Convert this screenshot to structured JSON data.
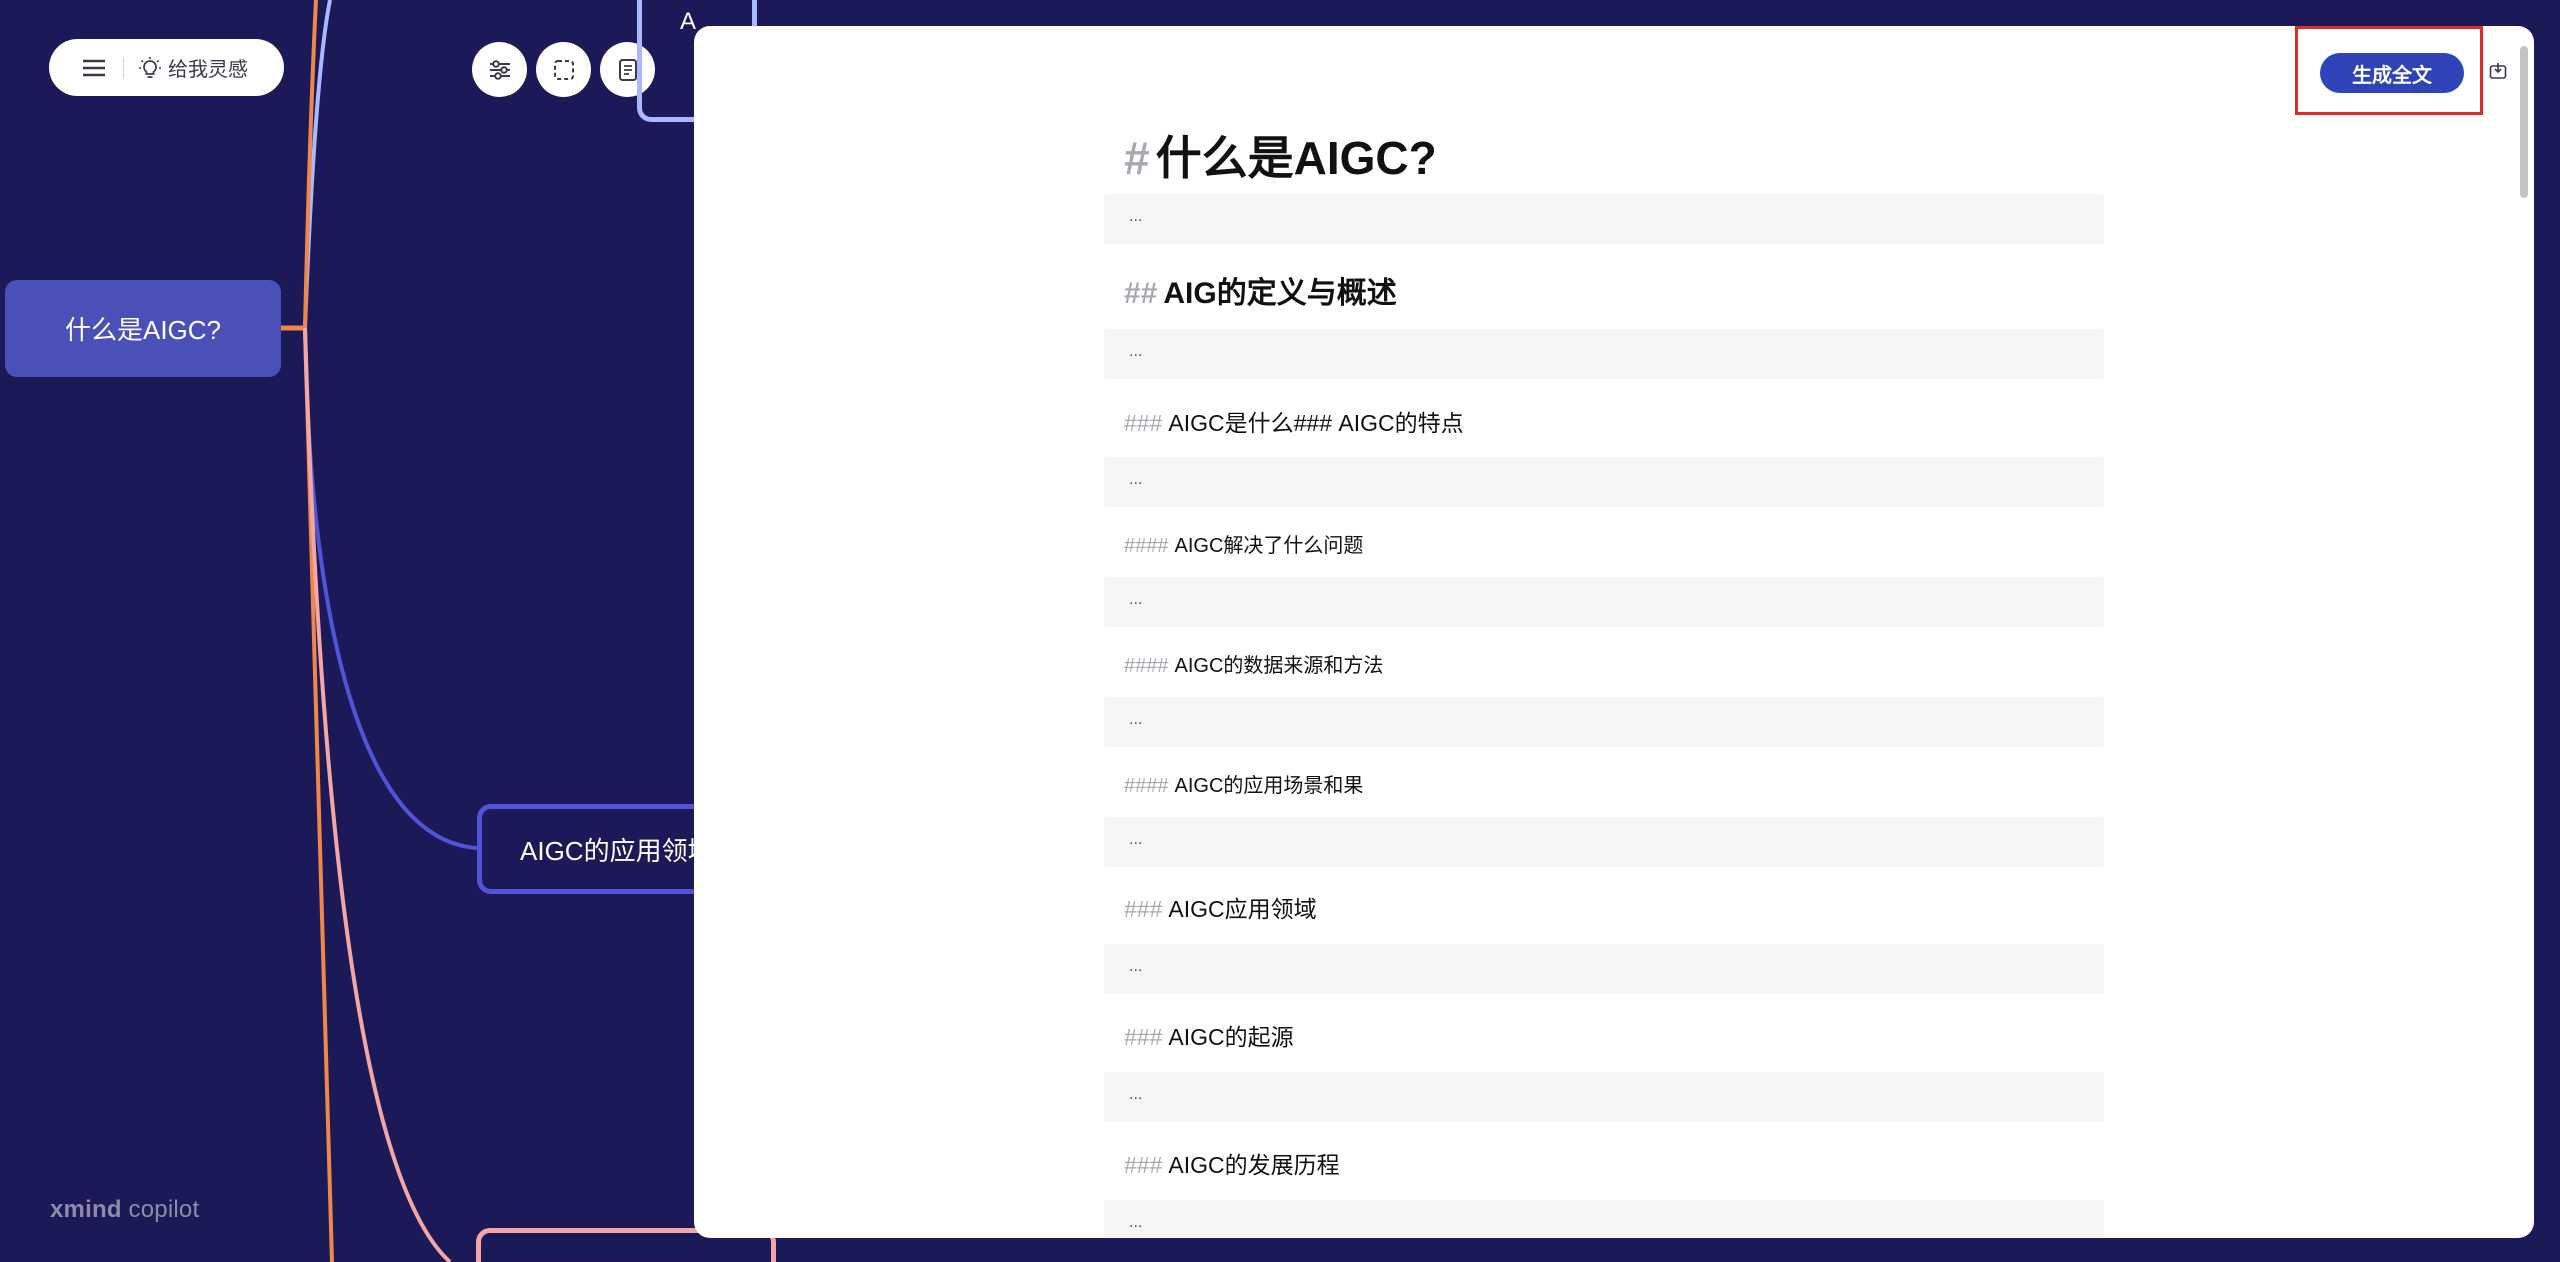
{
  "toolbar": {
    "inspire_label": "给我灵感"
  },
  "mindmap": {
    "root_topic": "什么是AIGC?",
    "top_topic_fragment": "A",
    "sub_topic": "AIGC的应用领域",
    "brand_bold": "xmind",
    "brand_rest": " copilot",
    "colors": {
      "background": "#1c1958",
      "root": "#4b4fb8",
      "branch_orange": "#f0864a",
      "branch_blue": "#4f55d6",
      "branch_light_blue": "#a9b8ff",
      "branch_pink": "#f3a6a6"
    }
  },
  "panel": {
    "generate_button": "生成全文",
    "accent": "#2d43b7",
    "highlight": "#e02b2b",
    "placeholder": "...",
    "h1": {
      "mark": "#",
      "text": "什么是AIGC?"
    },
    "h2": {
      "mark": "##",
      "text": "AIG的定义与概述"
    },
    "h3_a": {
      "mark": "###",
      "text": "AIGC是什么### AIGC的特点"
    },
    "h4_a": {
      "mark": "####",
      "text": "AIGC解决了什么问题"
    },
    "h4_b": {
      "mark": "####",
      "text": "AIGC的数据来源和方法"
    },
    "h4_c": {
      "mark": "####",
      "text": "AIGC的应用场景和果"
    },
    "h3_b": {
      "mark": "###",
      "text": "AIGC应用领域"
    },
    "h3_c": {
      "mark": "###",
      "text": "AIGC的起源"
    },
    "h3_d": {
      "mark": "###",
      "text": "AIGC的发展历程"
    }
  }
}
